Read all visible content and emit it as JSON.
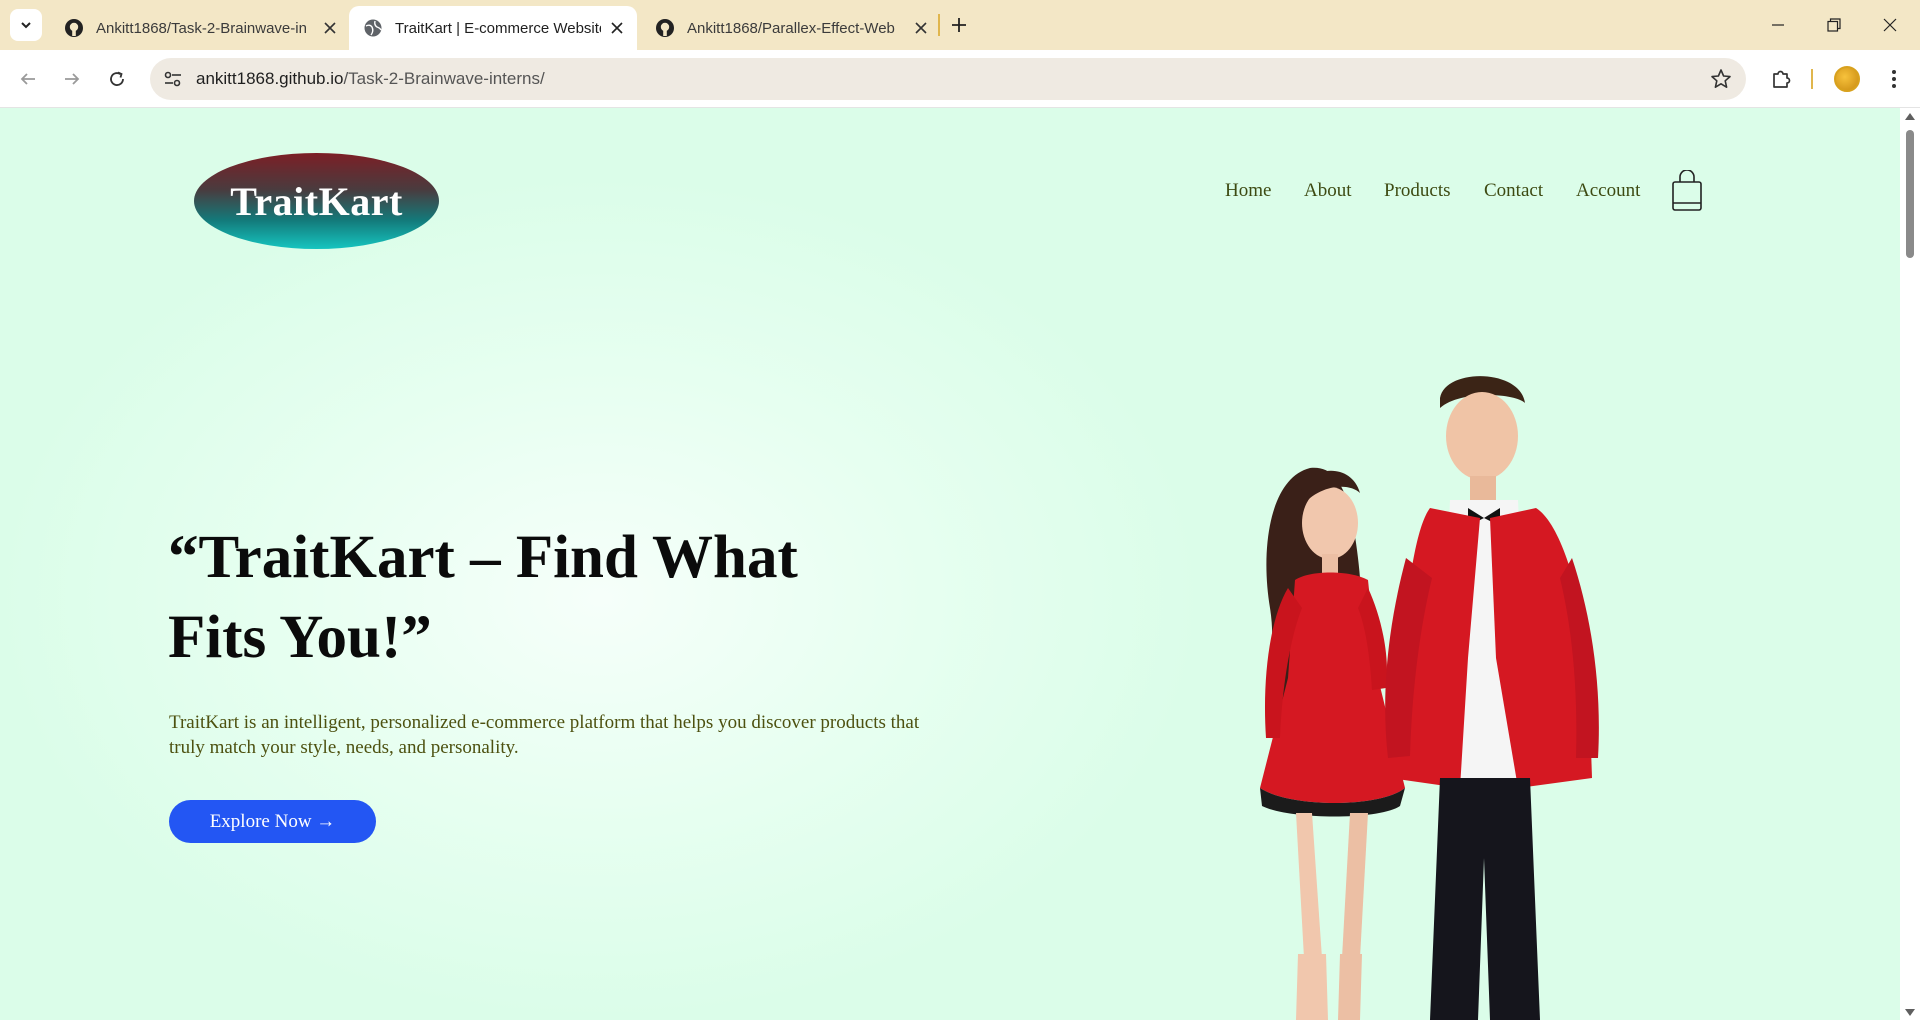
{
  "browser": {
    "tabs": [
      {
        "title": "Ankitt1868/Task-2-Brainwave-in",
        "favicon": "github-icon",
        "active": false
      },
      {
        "title": "TraitKart | E-commerce Website",
        "favicon": "globe-icon",
        "active": true
      },
      {
        "title": "Ankitt1868/Parallex-Effect-Web",
        "favicon": "github-icon",
        "active": false
      }
    ],
    "url_host": "ankitt1868.github.io",
    "url_path": "/Task-2-Brainwave-interns/"
  },
  "site": {
    "logo_text": "TraitKart",
    "nav": [
      "Home",
      "About",
      "Products",
      "Contact",
      "Account"
    ],
    "hero": {
      "title_line1": "“TraitKart – Find What",
      "title_line2": "Fits You!”",
      "description": "TraitKart is an intelligent, personalized e-commerce platform that helps you discover products that truly match your style, needs, and personality.",
      "cta_label": "Explore Now →"
    }
  },
  "colors": {
    "page_background": "#dffdea",
    "cta_background": "#2356f3",
    "nav_text": "#3d4a12",
    "logo_top": "#7c1f26",
    "logo_bottom": "#16c5c0",
    "dress_red": "#d51822"
  }
}
